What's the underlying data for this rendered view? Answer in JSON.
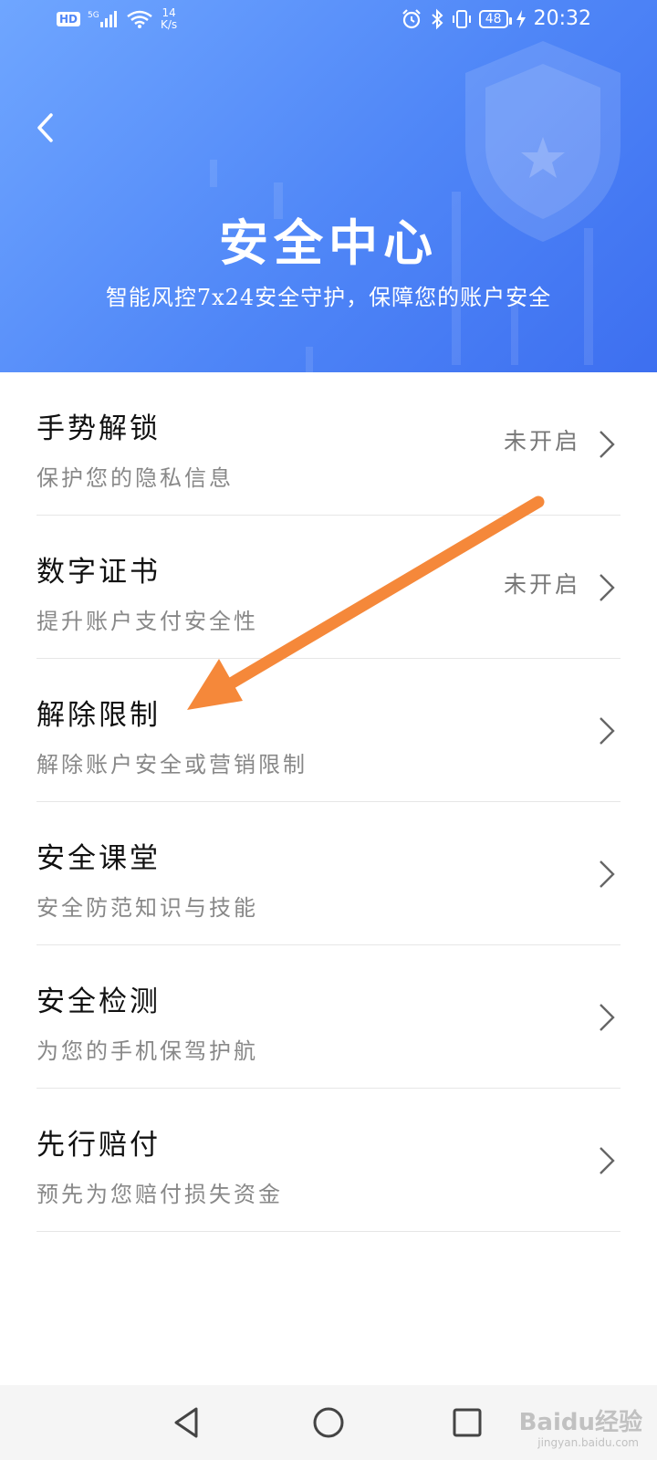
{
  "status_bar": {
    "hd": "HD",
    "network": "5G",
    "net_speed_value": "14",
    "net_speed_unit": "K/s",
    "battery": "48",
    "time": "20:32"
  },
  "header": {
    "title": "安全中心",
    "subtitle": "智能风控7x24安全守护，保障您的账户安全"
  },
  "menu": {
    "items": [
      {
        "title": "手势解锁",
        "subtitle": "保护您的隐私信息",
        "status": "未开启"
      },
      {
        "title": "数字证书",
        "subtitle": "提升账户支付安全性",
        "status": "未开启"
      },
      {
        "title": "解除限制",
        "subtitle": "解除账户安全或营销限制",
        "status": ""
      },
      {
        "title": "安全课堂",
        "subtitle": "安全防范知识与技能",
        "status": ""
      },
      {
        "title": "安全检测",
        "subtitle": "为您的手机保驾护航",
        "status": ""
      },
      {
        "title": "先行赔付",
        "subtitle": "预先为您赔付损失资金",
        "status": ""
      }
    ]
  },
  "watermark": {
    "brand": "Baidu经验",
    "url": "jingyan.baidu.com"
  },
  "colors": {
    "header_start": "#6fa6ff",
    "header_end": "#3d6ff0",
    "annotation_arrow": "#f5883a"
  },
  "icons": [
    "back-arrow-icon",
    "shield-icon",
    "chevron-right-icon",
    "nav-back-icon",
    "nav-home-icon",
    "nav-recents-icon"
  ]
}
